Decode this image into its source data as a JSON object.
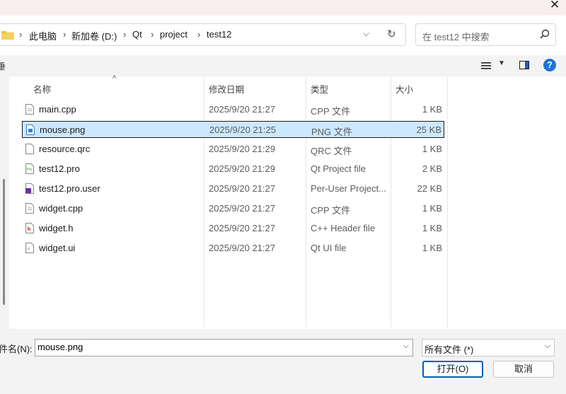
{
  "window": {
    "close_glyph": "✕"
  },
  "address": {
    "crumbs": [
      "此电脑",
      "新加卷 (D:)",
      "Qt",
      "project",
      "test12"
    ]
  },
  "search": {
    "placeholder": "在 test12 中搜索"
  },
  "toolbar": {
    "left_fragment": "垂"
  },
  "columns": {
    "name": "名称",
    "modified": "修改日期",
    "type": "类型",
    "size": "大小"
  },
  "files": [
    {
      "name": "main.cpp",
      "modified": "2025/9/20 21:27",
      "type": "CPP 文件",
      "size": "1 KB",
      "icon": "cpp-file-icon",
      "selected": false
    },
    {
      "name": "mouse.png",
      "modified": "2025/9/20 21:25",
      "type": "PNG 文件",
      "size": "25 KB",
      "icon": "png-file-icon",
      "selected": true
    },
    {
      "name": "resource.qrc",
      "modified": "2025/9/20 21:29",
      "type": "QRC 文件",
      "size": "1 KB",
      "icon": "qrc-file-icon",
      "selected": false
    },
    {
      "name": "test12.pro",
      "modified": "2025/9/20 21:29",
      "type": "Qt Project file",
      "size": "2 KB",
      "icon": "qt-pro-file-icon",
      "selected": false
    },
    {
      "name": "test12.pro.user",
      "modified": "2025/9/20 21:27",
      "type": "Per-User Project...",
      "size": "22 KB",
      "icon": "qt-user-file-icon",
      "selected": false
    },
    {
      "name": "widget.cpp",
      "modified": "2025/9/20 21:27",
      "type": "CPP 文件",
      "size": "1 KB",
      "icon": "cpp-file-icon",
      "selected": false
    },
    {
      "name": "widget.h",
      "modified": "2025/9/20 21:27",
      "type": "C++ Header file",
      "size": "1 KB",
      "icon": "header-file-icon",
      "selected": false
    },
    {
      "name": "widget.ui",
      "modified": "2025/9/20 21:27",
      "type": "Qt UI file",
      "size": "1 KB",
      "icon": "ui-file-icon",
      "selected": false
    }
  ],
  "bottom": {
    "filename_label": "件名(N):",
    "filename_value": "mouse.png",
    "filetype_value": "所有文件  (*)",
    "open_label": "打开(O)",
    "cancel_label": "取消"
  },
  "colors": {
    "selection": "#cce8ff",
    "accent": "#005fb8",
    "folder": "#f0c244"
  }
}
